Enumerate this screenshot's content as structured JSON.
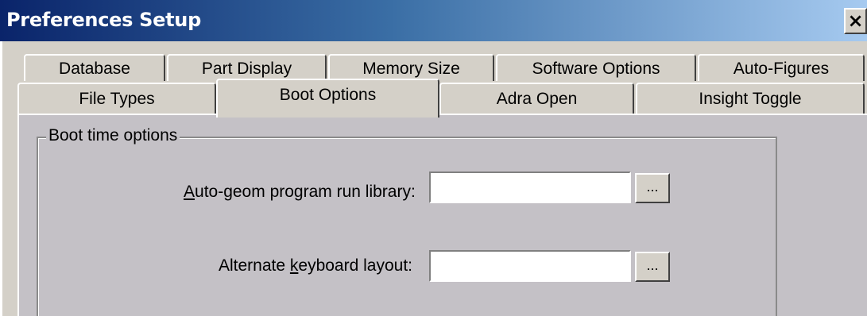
{
  "window": {
    "title": "Preferences Setup",
    "close_label": "×"
  },
  "tabs_row1": [
    {
      "label": "Database"
    },
    {
      "label": "Part Display"
    },
    {
      "label": "Memory Size"
    },
    {
      "label": "Software Options"
    },
    {
      "label": "Auto-Figures"
    }
  ],
  "tabs_row2": [
    {
      "label": "File Types"
    },
    {
      "label": "Boot Options",
      "selected": true
    },
    {
      "label": "Adra Open"
    },
    {
      "label": "Insight Toggle"
    }
  ],
  "group": {
    "legend": "Boot time options"
  },
  "fields": {
    "autogeom": {
      "label_mnemonic": "A",
      "label_rest": "uto-geom program run library:",
      "value": "",
      "browse_label": "..."
    },
    "keyboard": {
      "label_pre": "Alternate ",
      "label_mnemonic": "k",
      "label_rest": "eyboard layout:",
      "value": "",
      "browse_label": "..."
    }
  }
}
